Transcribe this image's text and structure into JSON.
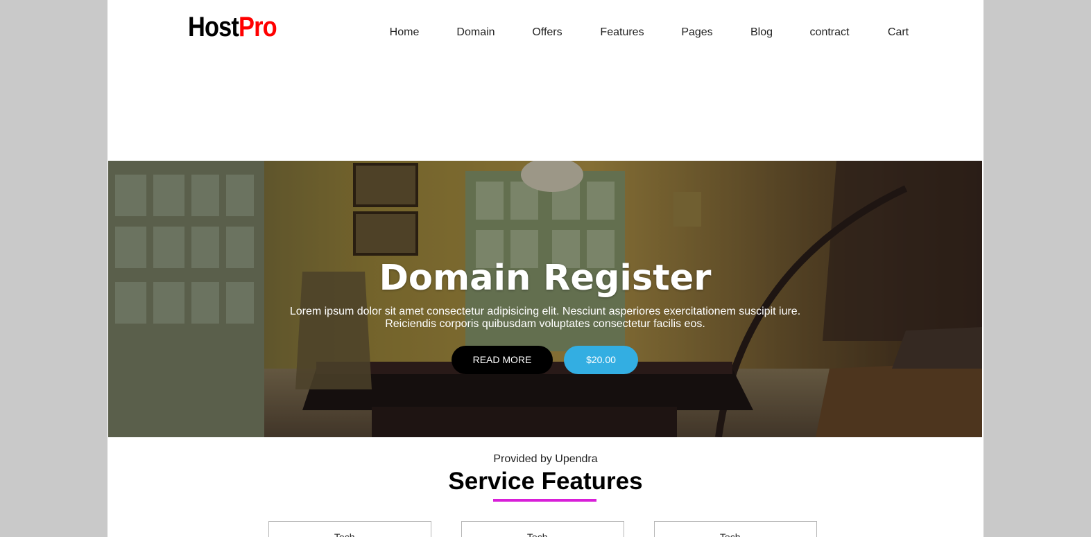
{
  "brand": {
    "part1": "Host",
    "part2": "Pro",
    "part1_color": "#000000",
    "part2_color": "#ff0000"
  },
  "nav": {
    "items": [
      {
        "label": "Home"
      },
      {
        "label": "Domain"
      },
      {
        "label": "Offers"
      },
      {
        "label": "Features"
      },
      {
        "label": "Pages"
      },
      {
        "label": "Blog"
      },
      {
        "label": "contract"
      },
      {
        "label": "Cart"
      }
    ]
  },
  "hero": {
    "title": "Domain Register",
    "text_line1": "Lorem ipsum dolor sit amet consectetur adipisicing elit. Nesciunt asperiores exercitationem suscipit iure.",
    "text_line2": "Reiciendis corporis quibusdam voluptates consectetur facilis eos.",
    "read_more_label": "READ MORE",
    "price_label": "$20.00",
    "price_button_color": "#33aee2"
  },
  "features": {
    "provided_by": "Provided by Upendra",
    "title": "Service Features",
    "underline_color": "#d81fd8",
    "cards": [
      {
        "label": "Tech...."
      },
      {
        "label": "Tech...."
      },
      {
        "label": "Tech...."
      }
    ]
  }
}
